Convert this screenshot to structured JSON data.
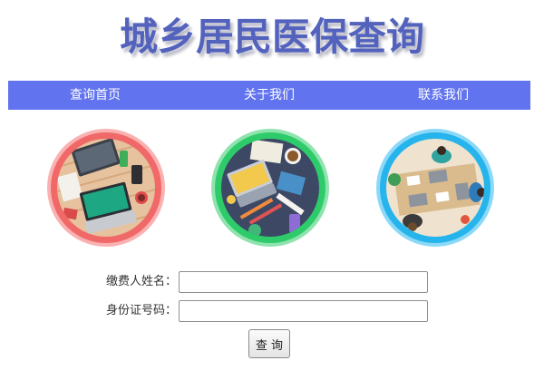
{
  "page": {
    "title": "城乡居民医保查询"
  },
  "nav": {
    "items": [
      {
        "label": "查询首页"
      },
      {
        "label": "关于我们"
      },
      {
        "label": "联系我们"
      }
    ]
  },
  "gallery": [
    {
      "icon": "office-desk-illustration",
      "ring_color": "#f06868"
    },
    {
      "icon": "workspace-tools-illustration",
      "ring_color": "#2ecb6b"
    },
    {
      "icon": "team-meeting-illustration",
      "ring_color": "#26b4ec"
    }
  ],
  "form": {
    "name_label": "缴费人姓名：",
    "name_value": "",
    "id_label": "身份证号码：",
    "id_value": "",
    "submit_label": "查 询"
  },
  "colors": {
    "title": "#5262bd",
    "nav_background": "#6173ee",
    "nav_text": "#ffffff"
  }
}
